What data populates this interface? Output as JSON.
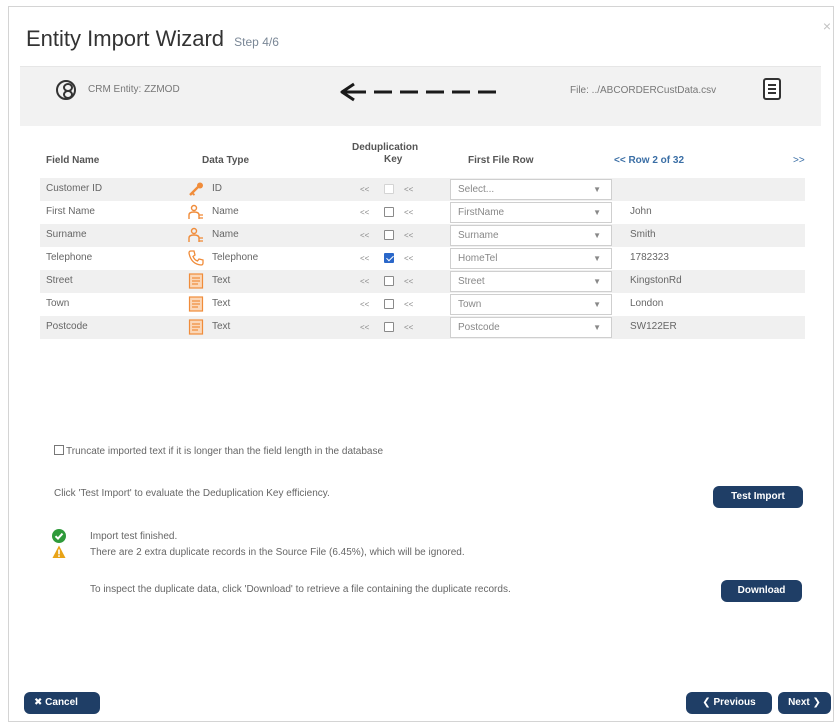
{
  "dialog": {
    "title": "Entity Import Wizard",
    "step": "Step 4/6",
    "close": "×"
  },
  "topbar": {
    "entity_label": "CRM Entity: ZZMOD",
    "file_label": "File: ../ABCORDERCustData.csv"
  },
  "columns": {
    "field_name": "Field Name",
    "data_type": "Data Type",
    "dedup_line1": "Deduplication",
    "dedup_line2": "Key",
    "first_file_row": "First File Row",
    "row_nav": "<< Row 2 of 32",
    "row_next": ">>"
  },
  "rows": [
    {
      "field": "Customer ID",
      "type": "ID",
      "type_icon": "key-icon",
      "checked": false,
      "disabled": true,
      "mapping": "Select...",
      "sample": ""
    },
    {
      "field": "First Name",
      "type": "Name",
      "type_icon": "name-icon",
      "checked": false,
      "disabled": false,
      "mapping": "FirstName",
      "sample": "John"
    },
    {
      "field": "Surname",
      "type": "Name",
      "type_icon": "name-icon",
      "checked": false,
      "disabled": false,
      "mapping": "Surname",
      "sample": "Smith"
    },
    {
      "field": "Telephone",
      "type": "Telephone",
      "type_icon": "telephone-icon",
      "checked": true,
      "disabled": false,
      "mapping": "HomeTel",
      "sample": "1782323"
    },
    {
      "field": "Street",
      "type": "Text",
      "type_icon": "text-icon",
      "checked": false,
      "disabled": false,
      "mapping": "Street",
      "sample": "KingstonRd"
    },
    {
      "field": "Town",
      "type": "Text",
      "type_icon": "text-icon",
      "checked": false,
      "disabled": false,
      "mapping": "Town",
      "sample": "London"
    },
    {
      "field": "Postcode",
      "type": "Text",
      "type_icon": "text-icon",
      "checked": false,
      "disabled": false,
      "mapping": "Postcode",
      "sample": "SW122ER"
    }
  ],
  "dedup_arrows": {
    "left": "<<",
    "right": "<<"
  },
  "options": {
    "truncate_label": "Truncate imported text if it is longer than the field length in the database"
  },
  "test": {
    "hint": "Click 'Test Import' to evaluate the Deduplication Key efficiency.",
    "button": "Test Import",
    "finished": "Import test finished.",
    "warning": "There are 2 extra duplicate records in the Source File (6.45%), which will be ignored.",
    "inspect": "To inspect the duplicate data, click 'Download' to retrieve a file containing the duplicate records.",
    "download_button": "Download"
  },
  "footer": {
    "cancel": "✖ Cancel",
    "previous": "❮ Previous",
    "next": "Next ❯"
  },
  "colors": {
    "button_bg": "#1f3e66",
    "checkbox_checked": "#2a67c9",
    "success": "#2e9a3a",
    "warning": "#e8a317",
    "type_icon": "#f08c3a"
  }
}
